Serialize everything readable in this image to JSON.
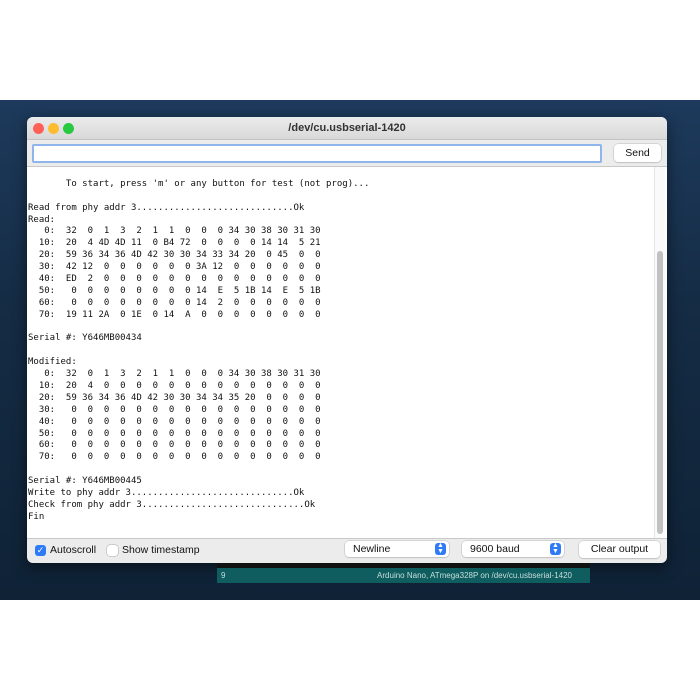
{
  "window": {
    "title": "/dev/cu.usbserial-1420"
  },
  "input": {
    "value": "",
    "send_label": "Send"
  },
  "output": {
    "lines": [
      "",
      "       To start, press 'm' or any button for test (not prog)...",
      "",
      "Read from phy addr 3.............................Ok",
      "Read:",
      "   0:  32  0  1  3  2  1  1  0  0  0 34 30 38 30 31 30",
      "  10:  20  4 4D 4D 11  0 B4 72  0  0  0  0 14 14  5 21",
      "  20:  59 36 34 36 4D 42 30 30 34 33 34 20  0 45  0  0",
      "  30:  42 12  0  0  0  0  0  0 3A 12  0  0  0  0  0  0",
      "  40:  ED  2  0  0  0  0  0  0  0  0  0  0  0  0  0  0",
      "  50:   0  0  0  0  0  0  0  0 14  E  5 1B 14  E  5 1B",
      "  60:   0  0  0  0  0  0  0  0 14  2  0  0  0  0  0  0",
      "  70:  19 11 2A  0 1E  0 14  A  0  0  0  0  0  0  0  0",
      "",
      "Serial #: Y646MB00434",
      "",
      "Modified:",
      "   0:  32  0  1  3  2  1  1  0  0  0 34 30 38 30 31 30",
      "  10:  20  4  0  0  0  0  0  0  0  0  0  0  0  0  0  0",
      "  20:  59 36 34 36 4D 42 30 30 34 34 35 20  0  0  0  0",
      "  30:   0  0  0  0  0  0  0  0  0  0  0  0  0  0  0  0",
      "  40:   0  0  0  0  0  0  0  0  0  0  0  0  0  0  0  0",
      "  50:   0  0  0  0  0  0  0  0  0  0  0  0  0  0  0  0",
      "  60:   0  0  0  0  0  0  0  0  0  0  0  0  0  0  0  0",
      "  70:   0  0  0  0  0  0  0  0  0  0  0  0  0  0  0  0",
      "",
      "Serial #: Y646MB00445",
      "Write to phy addr 3..............................Ok",
      "Check from phy addr 3..............................Ok",
      "Fin"
    ]
  },
  "footer": {
    "autoscroll_label": "Autoscroll",
    "autoscroll_checked": true,
    "timestamp_label": "Show timestamp",
    "timestamp_checked": false,
    "line_ending": "Newline",
    "baud": "9600 baud",
    "clear_label": "Clear output"
  },
  "statusbar": {
    "line": "9",
    "board": "Arduino Nano, ATmega328P on /dev/cu.usbserial-1420"
  },
  "colors": {
    "accent": "#2f7bf5",
    "close": "#fe5f57",
    "minimize": "#febc2e",
    "zoom": "#28c840",
    "statusbar": "#0f5d5f"
  }
}
